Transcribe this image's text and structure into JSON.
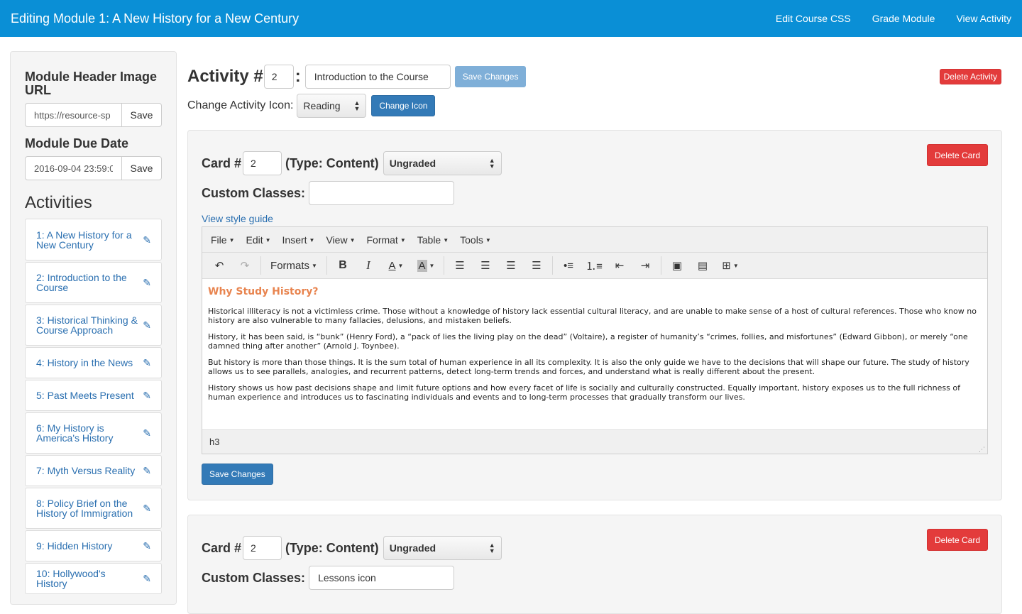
{
  "header": {
    "title": "Editing Module 1: A New History for a New Century",
    "nav": [
      "Edit Course CSS",
      "Grade Module",
      "View Activity"
    ]
  },
  "sidebar": {
    "header_image_label": "Module Header Image URL",
    "header_image_value": "https://resource-sp",
    "save_label": "Save",
    "due_date_label": "Module Due Date",
    "due_date_value": "2016-09-04 23:59:0",
    "activities_title": "Activities",
    "activities": [
      "1: A New History for a New Century",
      "2: Introduction to the Course",
      "3: Historical Thinking & Course Approach",
      "4: History in the News",
      "5: Past Meets Present",
      "6: My History is America's History",
      "7: Myth Versus Reality",
      "8: Policy Brief on the History of Immigration",
      "9: Hidden History",
      "10: Hollywood's History"
    ]
  },
  "activity": {
    "label": "Activity #",
    "colon": ":",
    "number": "2",
    "title": "Introduction to the Course",
    "save_label": "Save Changes",
    "delete_label": "Delete Activity",
    "icon_label": "Change Activity Icon:",
    "icon_value": "Reading",
    "change_icon_label": "Change Icon"
  },
  "cards": [
    {
      "label": "Card #",
      "number": "2",
      "type": "(Type: Content)",
      "grading": "Ungraded",
      "delete_label": "Delete Card",
      "classes_label": "Custom Classes:",
      "classes_value": "",
      "style_guide": "View style guide",
      "save_label": "Save Changes"
    },
    {
      "label": "Card #",
      "number": "2",
      "type": "(Type: Content)",
      "grading": "Ungraded",
      "delete_label": "Delete Card",
      "classes_label": "Custom Classes:",
      "classes_value": "Lessons icon"
    }
  ],
  "editor": {
    "menus": [
      "File",
      "Edit",
      "Insert",
      "View",
      "Format",
      "Table",
      "Tools"
    ],
    "formats_label": "Formats",
    "heading": "Why Study History?",
    "paragraphs": [
      "Historical illiteracy is not a victimless crime. Those without a knowledge of history lack essential cultural literacy, and are unable to make sense of a host of cultural references. Those who know no history are also vulnerable to many fallacies, delusions, and mistaken beliefs.",
      "History, it has been said, is “bunk” (Henry Ford), a “pack of lies the living play on the dead” (Voltaire), a register of humanity’s “crimes, follies, and misfortunes” (Edward Gibbon), or merely “one damned thing after another” (Arnold J. Toynbee).",
      "But history is more than those things.  It is the sum total of human experience in all its complexity.  It is also the only guide we have to the decisions that will shape our future. The study of history allows us to see parallels, analogies, and recurrent patterns, detect long-term trends and forces, and understand what is really different about the present.",
      "History shows us how past decisions shape and limit future options and how every facet of life is socially and culturally constructed.  Equally important, history exposes us to the full richness of human experience and introduces us to fascinating individuals and events and to long-term processes that gradually transform our lives."
    ],
    "status_path": "h3"
  },
  "colors": {
    "topbar": "#0a8fd6",
    "primary": "#337ab7",
    "danger": "#e33b3b",
    "heading_orange": "#e8844f",
    "link": "#2a6fb0"
  }
}
